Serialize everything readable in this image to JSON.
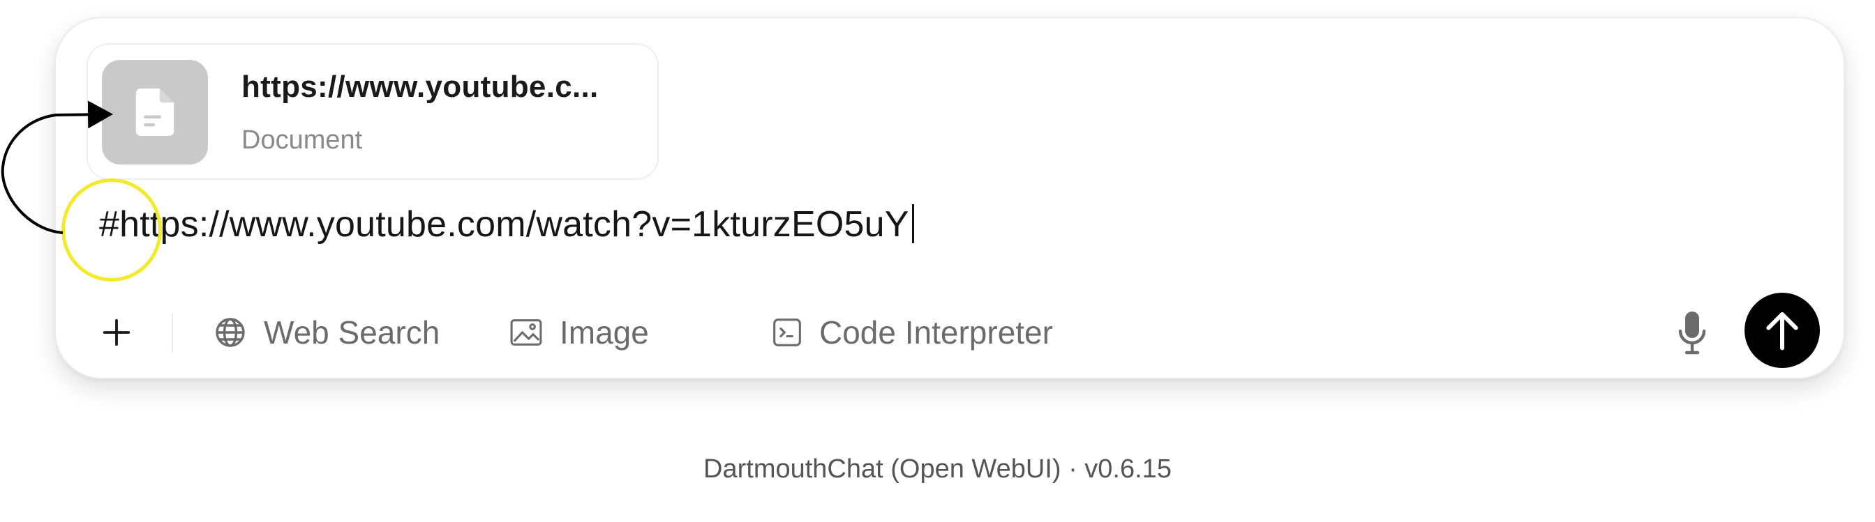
{
  "file_card": {
    "name": "https://www.youtube.c...",
    "type": "Document",
    "icon": "document-icon"
  },
  "prompt": {
    "value": "#https://www.youtube.com/watch?v=1kturzEO5uY"
  },
  "toolbar": {
    "add_icon": "plus-icon",
    "web_search_label": "Web Search",
    "image_label": "Image",
    "code_interpreter_label": "Code Interpreter",
    "mic_icon": "microphone-icon",
    "send_icon": "arrow-up-icon"
  },
  "footer": {
    "version_text": "DartmouthChat (Open WebUI) · v0.6.15"
  },
  "annotations": {
    "highlight_color": "#f2ea2a",
    "arrow_color": "#000000"
  },
  "colors": {
    "send_button_bg": "#000000",
    "thumbnail_bg": "#c9c9c9",
    "muted_text": "#6b6b6b"
  }
}
